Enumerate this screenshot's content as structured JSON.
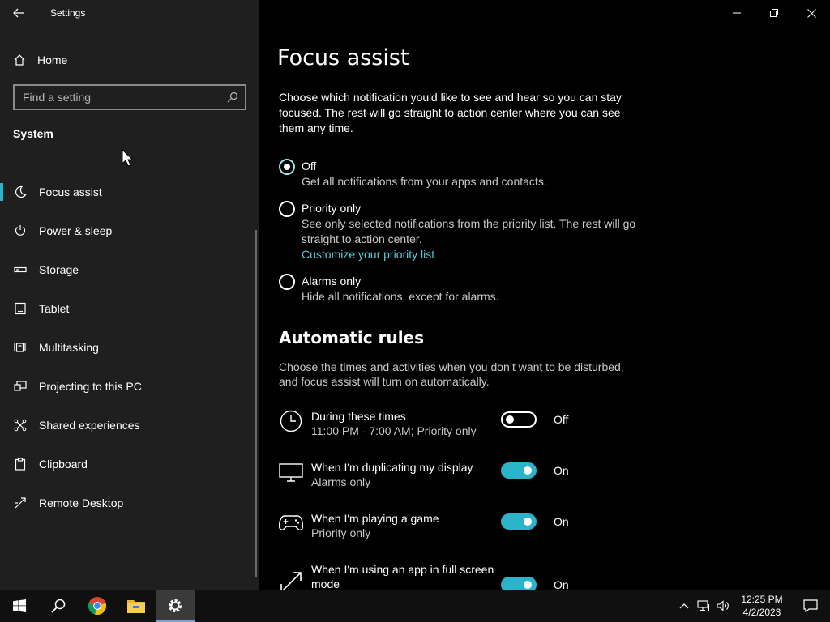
{
  "window": {
    "title": "Settings"
  },
  "sidebar": {
    "home_label": "Home",
    "search_placeholder": "Find a setting",
    "section_title": "System",
    "items": [
      {
        "label": "Focus assist",
        "icon": "moon-icon",
        "active": true
      },
      {
        "label": "Power & sleep",
        "icon": "power-icon"
      },
      {
        "label": "Storage",
        "icon": "storage-icon"
      },
      {
        "label": "Tablet",
        "icon": "tablet-icon"
      },
      {
        "label": "Multitasking",
        "icon": "multitasking-icon"
      },
      {
        "label": "Projecting to this PC",
        "icon": "projecting-icon"
      },
      {
        "label": "Shared experiences",
        "icon": "shared-experiences-icon"
      },
      {
        "label": "Clipboard",
        "icon": "clipboard-icon"
      },
      {
        "label": "Remote Desktop",
        "icon": "remote-desktop-icon"
      }
    ]
  },
  "main": {
    "title": "Focus assist",
    "intro": "Choose which notification you'd like to see and hear so you can stay focused. The rest will go straight to action center where you can see them any time.",
    "options": [
      {
        "label": "Off",
        "desc": "Get all notifications from your apps and contacts.",
        "checked": true
      },
      {
        "label": "Priority only",
        "desc": "See only selected notifications from the priority list. The rest will go straight to action center.",
        "link": "Customize your priority list",
        "checked": false
      },
      {
        "label": "Alarms only",
        "desc": "Hide all notifications, except for alarms.",
        "checked": false
      }
    ],
    "rules_heading": "Automatic rules",
    "rules_desc": "Choose the times and activities when you don’t want to be disturbed, and focus assist will turn on automatically.",
    "rules": [
      {
        "title": "During these times",
        "sub": "11:00 PM - 7:00 AM; Priority only",
        "state": "Off",
        "on": false,
        "icon": "clock-icon"
      },
      {
        "title": "When I'm duplicating my display",
        "sub": "Alarms only",
        "state": "On",
        "on": true,
        "icon": "monitor-icon"
      },
      {
        "title": "When I'm playing a game",
        "sub": "Priority only",
        "state": "On",
        "on": true,
        "icon": "gamepad-icon"
      },
      {
        "title": "When I'm using an app in full screen mode",
        "sub": "",
        "state": "On",
        "on": true,
        "icon": "fullscreen-icon"
      }
    ]
  },
  "taskbar": {
    "time": "12:25 PM",
    "date": "4/2/2023"
  },
  "colors": {
    "accent": "#2bb3c9",
    "sidebar_bg": "#1f1f1f",
    "link": "#5cc8da"
  }
}
